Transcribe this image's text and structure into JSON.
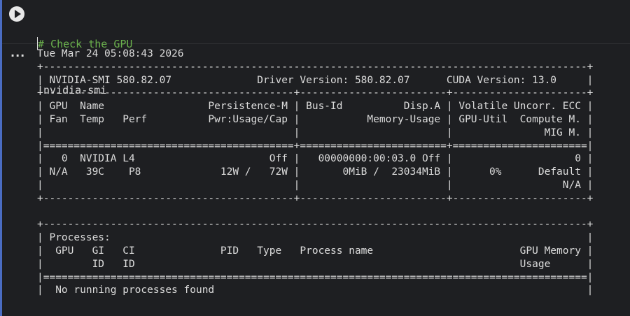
{
  "code": {
    "comment": "# Check the GPU",
    "bang": "!",
    "command": "nvidia-smi"
  },
  "output_lines": [
    "Tue Mar 24 05:08:43 2026",
    "+-----------------------------------------------------------------------------------------+",
    "| NVIDIA-SMI 580.82.07              Driver Version: 580.82.07      CUDA Version: 13.0     |",
    "+-----------------------------------------+------------------------+----------------------+",
    "| GPU  Name                 Persistence-M | Bus-Id          Disp.A | Volatile Uncorr. ECC |",
    "| Fan  Temp   Perf          Pwr:Usage/Cap |           Memory-Usage | GPU-Util  Compute M. |",
    "|                                         |                        |               MIG M. |",
    "|=========================================+========================+======================|",
    "|   0  NVIDIA L4                      Off |   00000000:00:03.0 Off |                    0 |",
    "| N/A   39C    P8             12W /   72W |       0MiB /  23034MiB |      0%      Default |",
    "|                                         |                        |                  N/A |",
    "+-----------------------------------------+------------------------+----------------------+",
    "",
    "+-----------------------------------------------------------------------------------------+",
    "| Processes:                                                                              |",
    "|  GPU   GI   CI              PID   Type   Process name                        GPU Memory |",
    "|        ID   ID                                                               Usage      |",
    "|=========================================================================================|",
    "|  No running processes found                                                             |"
  ]
}
